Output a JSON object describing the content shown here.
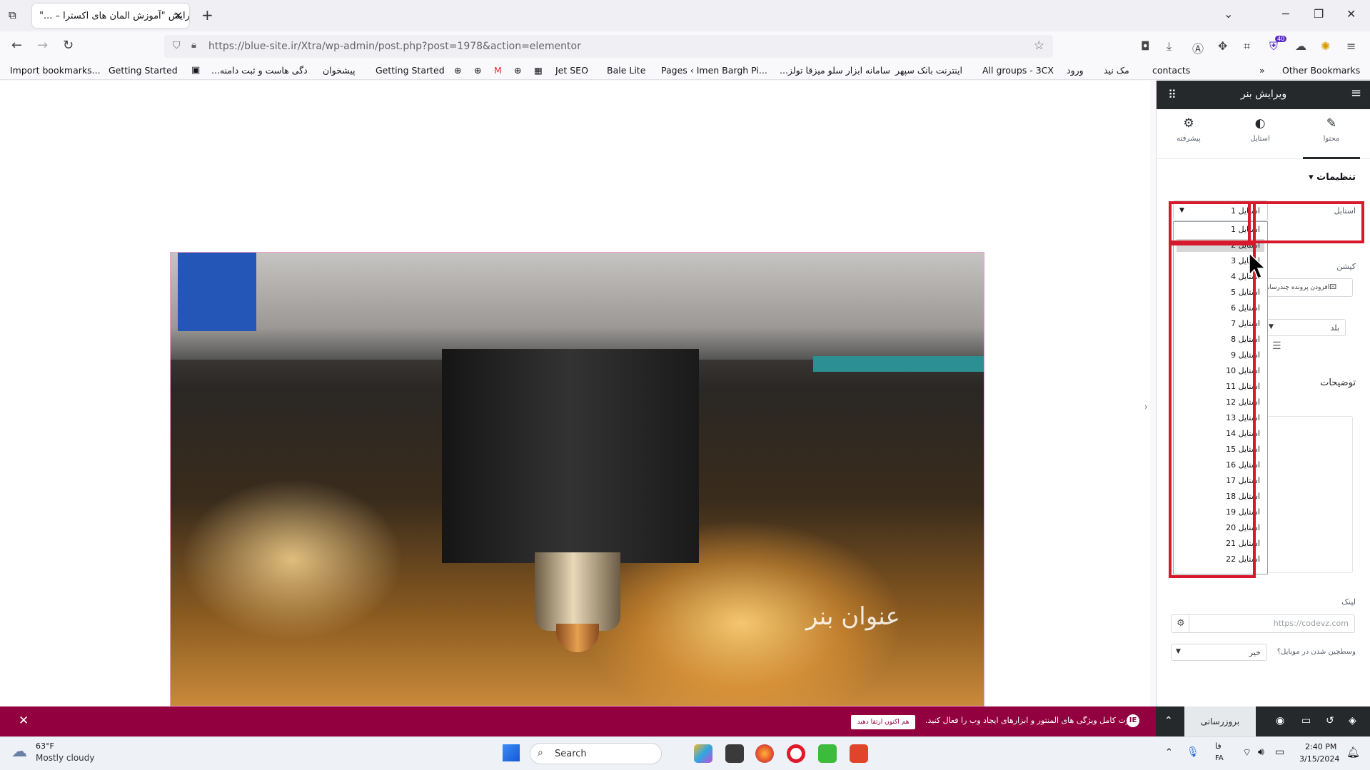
{
  "browser": {
    "tab_title": "ویرایش \"آموزش المان های اکسترا – ...\"",
    "url": "https://blue-site.ir/Xtra/wp-admin/post.php?post=1978&action=elementor",
    "bookmarks": [
      "Import bookmarks...",
      "Getting Started",
      "...دگی هاست و ثبت دامنه",
      "پیشخوان",
      "Getting Started",
      "Jet SEO",
      "Bale Lite",
      "Pages ‹ Imen Bargh Pi...",
      "...سامانه ابزار سلو میزقا تولز",
      "اینترنت بانک سپهر",
      "All groups - 3CX",
      "ورود",
      "مک نید",
      "contacts"
    ],
    "other_bookmarks": "Other Bookmarks",
    "badge": "40"
  },
  "canvas": {
    "banner_title": "عنوان بنر"
  },
  "panel": {
    "header_title": "ویرایش بنر",
    "tabs": [
      {
        "label": "محتوا",
        "icon": "pencil-icon"
      },
      {
        "label": "استایل",
        "icon": "half-circle-icon"
      },
      {
        "label": "پیشرفته",
        "icon": "gear-icon"
      }
    ],
    "section_title": "تنظیمات",
    "style_label": "استایل",
    "style_selected": "استایل 1",
    "caption_label": "کپشن",
    "add_media": "افزودن پرونده چندرسانه",
    "align_value": "بلد",
    "description_label": "توضیحات",
    "link_label": "لینک",
    "link_placeholder": "https://codevz.com",
    "mobile_center_label": "وسطچین شدن در موبایل؟",
    "mobile_center_value": "خیر",
    "options": [
      "استایل 1",
      "استایل 2",
      "استایل 3",
      "استایل 4",
      "استایل 5",
      "استایل 6",
      "استایل 7",
      "استایل 8",
      "استایل 9",
      "استایل 10",
      "استایل 11",
      "استایل 12",
      "استایل 13",
      "استایل 14",
      "استایل 15",
      "استایل 16",
      "استایل 17",
      "استایل 18",
      "استایل 19",
      "استایل 20",
      "استایل 21",
      "استایل 22"
    ]
  },
  "notice": {
    "text": "قدرت کامل ویژگی های المنتور و ابزارهای ایجاد وب را فعال کنید.",
    "button": "هم اکنون ارتقا دهید"
  },
  "panel_footer": {
    "update": "بروزرسانی"
  },
  "taskbar": {
    "weather_temp": "63°F",
    "weather_desc": "Mostly cloudy",
    "search": "Search",
    "lang": "فا",
    "lang_code": "FA",
    "time": "2:40 PM",
    "date": "3/15/2024"
  }
}
